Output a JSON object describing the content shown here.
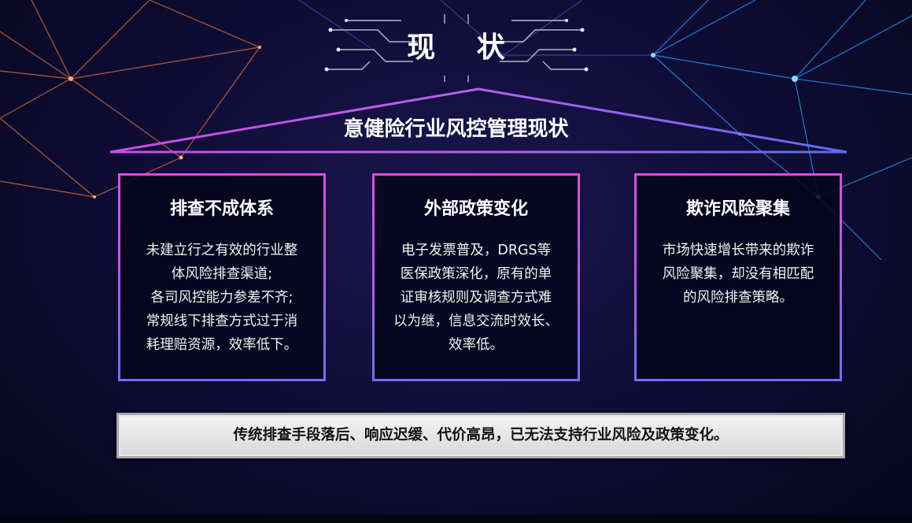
{
  "title": "现 状",
  "roof_title": "意健险行业风控管理现状",
  "cards": [
    {
      "title": "排查不成体系",
      "lines": [
        "未建立行之有效的行业整",
        "体风险排查渠道;",
        "各司风控能力参差不齐;",
        "常规线下排查方式过于消",
        "耗理赔资源，效率低下。"
      ]
    },
    {
      "title": "外部政策变化",
      "lines": [
        "电子发票普及，DRGS等",
        "医保政策深化，原有的单",
        "证审核规则及调查方式难",
        "以为继，信息交流时效长、",
        "效率低。"
      ]
    },
    {
      "title": "欺诈风险聚集",
      "lines": [
        "市场快速增长带来的欺诈",
        "风险聚集，却没有相匹配",
        "的风险排查策略。"
      ]
    }
  ],
  "conclusion": "传统排查手段落后、响应迟缓、代价高昂，已无法支持行业风险及政策变化。",
  "colors": {
    "background": "#0e0c33",
    "card_border_top": "#e04be0",
    "card_border_bottom": "#6f6ff2",
    "roof_line_left": "#c94be6",
    "roof_line_right": "#5d6cf0",
    "net_left": "#f0804a",
    "net_right": "#2aa6ff"
  }
}
